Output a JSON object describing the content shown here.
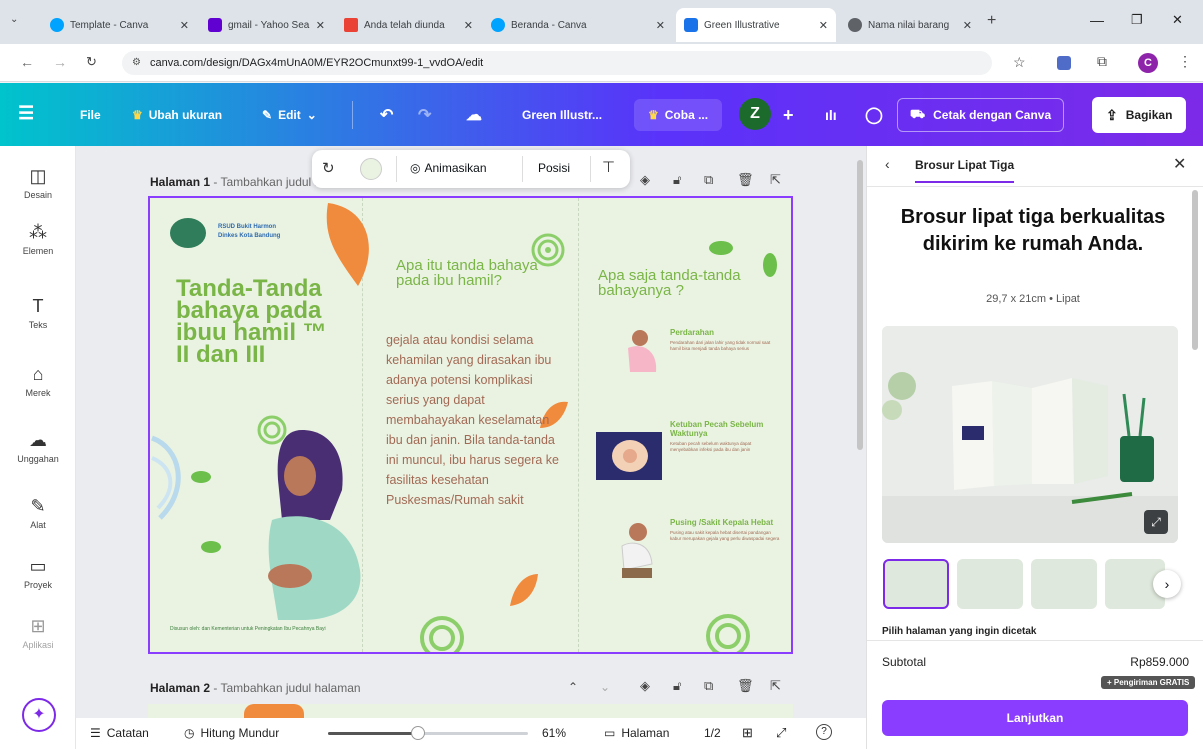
{
  "browser": {
    "tabs": [
      {
        "title": "Template - Canva",
        "color": "#00a3ff"
      },
      {
        "title": "gmail - Yahoo Sea",
        "color": "#6001d2"
      },
      {
        "title": "Anda telah diunda",
        "color": "#ea4335"
      },
      {
        "title": "Beranda - Canva",
        "color": "#00a3ff"
      },
      {
        "title": "Green Illustrative",
        "color": "#1a73e8"
      },
      {
        "title": "Nama nilai barang",
        "color": "#5f6368"
      }
    ],
    "url": "canva.com/design/DAGx4mUnA0M/EYR2OCmunxt99-1_vvdOA/edit",
    "profile_initial": "C"
  },
  "header": {
    "file": "File",
    "resize": "Ubah ukuran",
    "edit": "Edit",
    "doc_title": "Green Illustr...",
    "try": "Coba ...",
    "avatar": "Z",
    "print": "Cetak dengan Canva",
    "share": "Bagikan"
  },
  "rail": [
    {
      "label": "Desain",
      "icon": "◫"
    },
    {
      "label": "Elemen",
      "icon": "⁂"
    },
    {
      "label": "Teks",
      "icon": "T"
    },
    {
      "label": "Merek",
      "icon": "⌂"
    },
    {
      "label": "Unggahan",
      "icon": "☁"
    },
    {
      "label": "Alat",
      "icon": "✎"
    },
    {
      "label": "Proyek",
      "icon": "▭"
    },
    {
      "label": "Aplikasi",
      "icon": "⊞"
    }
  ],
  "toolbar": {
    "animate": "Animasikan",
    "position": "Posisi"
  },
  "pages": {
    "page1_label": "Halaman 1",
    "page1_hint": " - Tambahkan judul halaman",
    "page2_label": "Halaman 2",
    "page2_hint": " - Tambahkan judul halaman"
  },
  "brochure": {
    "logo_line1": "RSUD Bukit Harmon",
    "logo_line2": "Dinkes Kota Bandung",
    "title": "Tanda-Tanda bahaya pada ibuu hamil ™ II dan III",
    "footer_note": "Disusun oleh: dan Kementerian untuk Peningkatan Ibu Pecahnya Bayi",
    "q1": "Apa itu tanda bahaya pada ibu hamil?",
    "body": "gejala atau kondisi selama kehamilan yang dirasakan ibu adanya potensi komplikasi serius yang dapat membahayakan keselamatan ibu dan janin. Bila tanda-tanda ini muncul, ibu harus segera ke fasilitas kesehatan Puskesmas/Rumah sakit",
    "q2": "Apa saja tanda-tanda bahayanya ?",
    "items": [
      {
        "title": "Perdarahan",
        "text": "Pendarahan dari jalan lahir yang tidak normal saat hamil bisa menjadi tanda bahaya serius"
      },
      {
        "title": "Ketuban Pecah Sebelum Waktunya",
        "text": "Ketuban pecah sebelum waktunya dapat menyebabkan infeksi pada ibu dan janin"
      },
      {
        "title": "Pusing /Sakit Kepala Hebat",
        "text": "Pusing atau sakit kepala hebat disertai pandangan kabur merupakan gejala yang perlu diwaspadai segera"
      }
    ]
  },
  "footer": {
    "notes": "Catatan",
    "timer": "Hitung Mundur",
    "zoom": "61%",
    "pages": "Halaman",
    "page_count": "1/2",
    "zoom_level": 0.45
  },
  "panel": {
    "breadcrumb": "Brosur Lipat Tiga",
    "headline": "Brosur lipat tiga berkualitas dikirim ke rumah Anda.",
    "spec": "29,7 x 21cm • Lipat",
    "choose": "Pilih halaman yang ingin dicetak",
    "subtotal_label": "Subtotal",
    "subtotal_value": "Rp859.000",
    "shipping": "+ Pengiriman GRATIS",
    "continue": "Lanjutkan"
  },
  "colors": {
    "brand_purple": "#8b3dff",
    "title_green": "#7ab547",
    "body_brown": "#a26a55",
    "leaf_orange": "#f08a3c"
  }
}
